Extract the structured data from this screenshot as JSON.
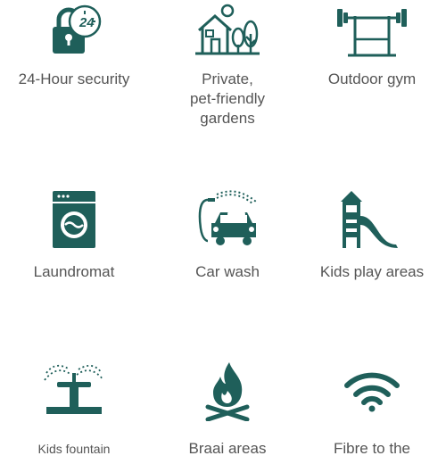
{
  "amenities": [
    {
      "label": "24-Hour security",
      "icon": "clock-lock-icon"
    },
    {
      "label": "Private,\npet-friendly\ngardens",
      "icon": "house-garden-icon"
    },
    {
      "label": "Outdoor gym",
      "icon": "gym-frame-icon"
    },
    {
      "label": "Laundromat",
      "icon": "washing-machine-icon"
    },
    {
      "label": "Car wash",
      "icon": "car-wash-icon"
    },
    {
      "label": "Kids play areas",
      "icon": "playground-slide-icon"
    },
    {
      "label": "Kids fountain",
      "icon": "fountain-sprinkler-icon"
    },
    {
      "label": "Braai areas",
      "icon": "fire-icon"
    },
    {
      "label": "Fibre to the",
      "icon": "wifi-icon"
    }
  ],
  "colors": {
    "icon": "#1f5f5a",
    "text": "#555555",
    "background": "#ffffff"
  }
}
